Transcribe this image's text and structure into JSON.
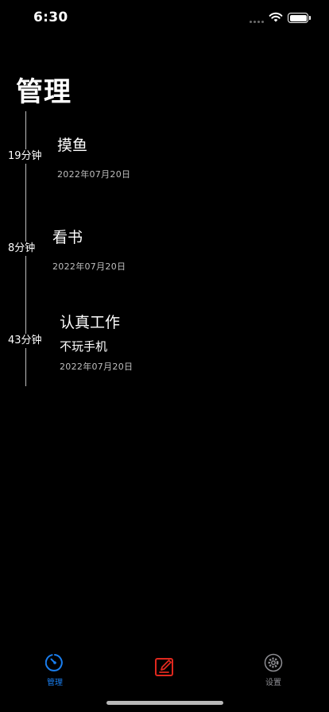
{
  "status_bar": {
    "time": "6:30"
  },
  "page": {
    "title": "管理"
  },
  "timeline": [
    {
      "duration": "19分钟",
      "title": "摸鱼",
      "note": "",
      "date": "2022年07月20日"
    },
    {
      "duration": "8分钟",
      "title": "看书",
      "note": "",
      "date": "2022年07月20日"
    },
    {
      "duration": "43分钟",
      "title": "认真工作",
      "note": "不玩手机",
      "date": "2022年07月20日"
    }
  ],
  "tab_bar": {
    "manage_label": "管理",
    "edit_label": "",
    "settings_label": "设置"
  },
  "colors": {
    "background": "#000000",
    "accent_blue": "#1a7ff0",
    "accent_red": "#e0281e",
    "inactive_gray": "#8e8e93"
  },
  "icons": {
    "manage": "stopwatch-icon",
    "edit": "edit-note-icon",
    "settings": "gear-icon"
  }
}
